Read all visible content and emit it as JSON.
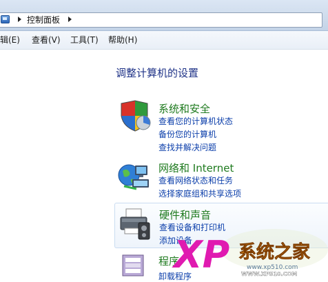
{
  "address_bar": {
    "breadcrumb": "控制面板",
    "icon": "control-panel-icon"
  },
  "menu": {
    "items": [
      "编辑(E)",
      "查看(V)",
      "工具(T)",
      "帮助(H)"
    ]
  },
  "main": {
    "title": "调整计算机的设置",
    "categories": [
      {
        "title": "系统和安全",
        "icon": "shield-icon",
        "links": [
          "查看您的计算机状态",
          "备份您的计算机",
          "查找并解决问题"
        ]
      },
      {
        "title": "网络和 Internet",
        "icon": "network-globe-icon",
        "links": [
          "查看网络状态和任务",
          "选择家庭组和共享选项"
        ]
      },
      {
        "title": "硬件和声音",
        "icon": "printer-icon",
        "links": [
          "查看设备和打印机",
          "添加设备"
        ]
      },
      {
        "title": "程序",
        "icon": "programs-icon",
        "links": [
          "卸载程序"
        ]
      }
    ]
  },
  "watermark": {
    "logo_letters": "XP",
    "brand": "系统之家",
    "url": "www.xp510.com",
    "url_caps": "WWW.XP510.COM"
  },
  "colors": {
    "title_blue": "#1e3287",
    "category_green": "#1e7a1e",
    "link_blue": "#0b3eaa"
  }
}
